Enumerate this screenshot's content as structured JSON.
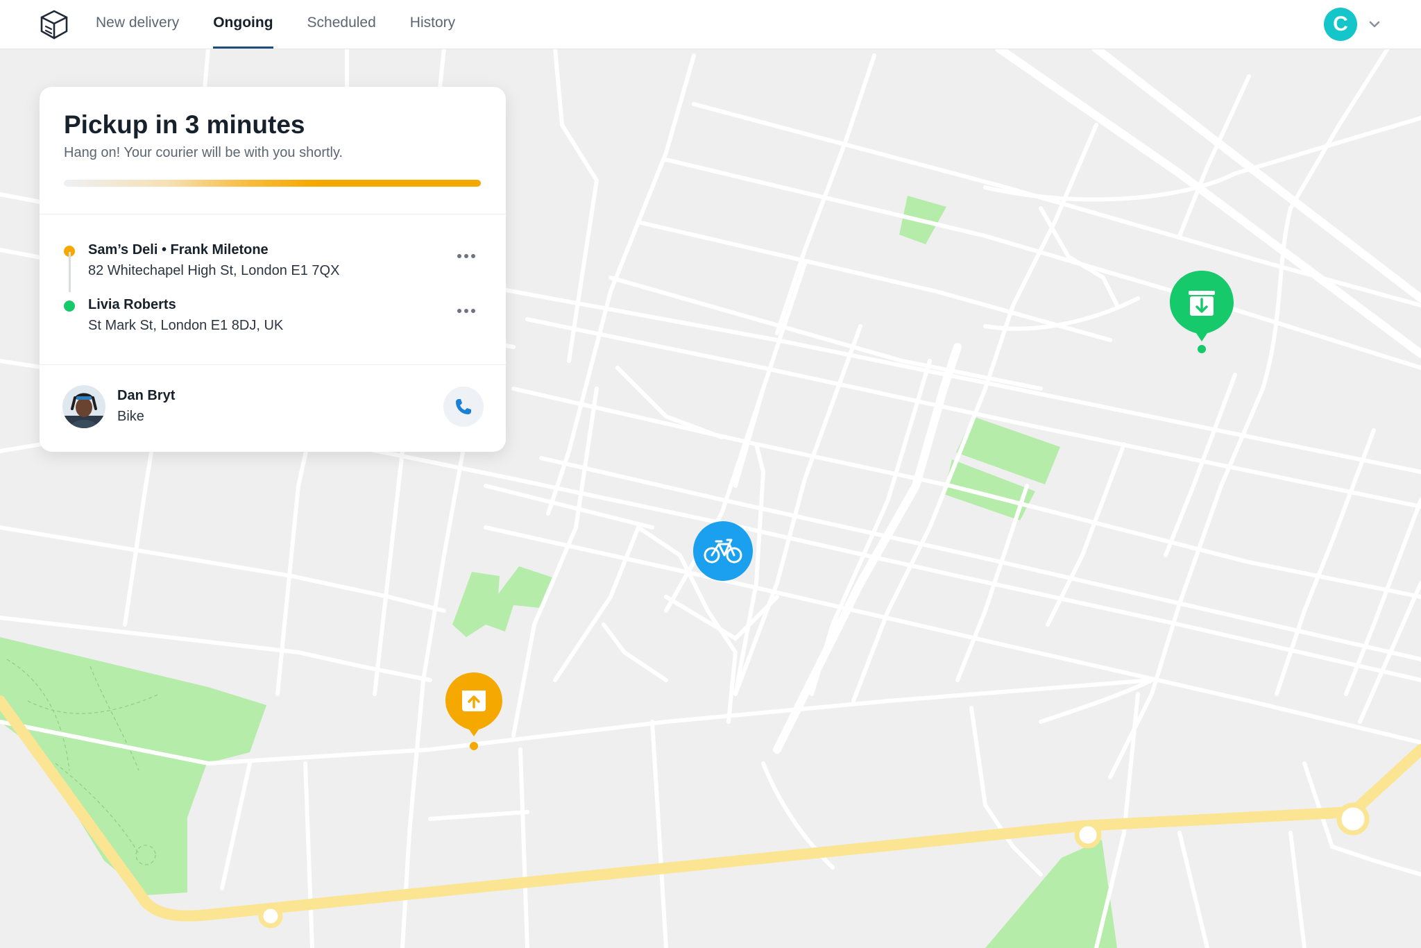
{
  "nav": {
    "items": [
      {
        "label": "New delivery"
      },
      {
        "label": "Ongoing"
      },
      {
        "label": "Scheduled"
      },
      {
        "label": "History"
      }
    ],
    "active_index": 1,
    "user_initial": "C"
  },
  "card": {
    "title": "Pickup in 3 minutes",
    "subtitle": "Hang on! Your courier will be with you shortly.",
    "progress_percent": 100,
    "stops": [
      {
        "name": "Sam’s Deli • Frank Miletone",
        "address": "82 Whitechapel High St, London E1 7QX",
        "color": "#f5a800"
      },
      {
        "name": "Livia Roberts",
        "address": "St Mark St, London E1 8DJ, UK",
        "color": "#16c96a"
      }
    ],
    "courier": {
      "name": "Dan Bryt",
      "mode": "Bike"
    }
  },
  "colors": {
    "pickup": "#f5a800",
    "dropoff": "#16c96a",
    "courier": "#1aa0ee",
    "accent": "#14c5c9",
    "nav_underline": "#1e4d7d",
    "park": "#b6ecaa",
    "road": "#ffffff",
    "rail": "#fbe592"
  },
  "icons": {
    "logo": "box-logo-icon",
    "menu": "chevron-down-icon",
    "more": "more-horizontal-icon",
    "call": "phone-icon",
    "pickup": "package-up-icon",
    "dropoff": "package-down-icon",
    "courier": "bicycle-icon"
  }
}
